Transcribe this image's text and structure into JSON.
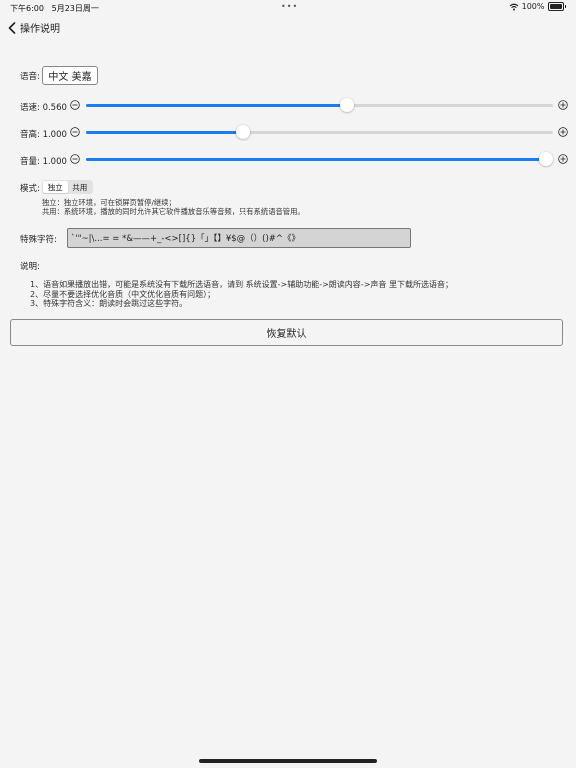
{
  "status": {
    "time": "下午6:00",
    "date": "5月23日周一",
    "dots": "•••",
    "battery": "100%"
  },
  "nav": {
    "back_label": "操作说明"
  },
  "voice": {
    "label": "语音:",
    "value": "中文 美嘉"
  },
  "sliders": [
    {
      "label": "语速: 0.560",
      "fraction": 0.558
    },
    {
      "label": "音高: 1.000",
      "fraction": 0.336
    },
    {
      "label": "音量: 1.000",
      "fraction": 0.985
    }
  ],
  "mode": {
    "label": "模式:",
    "options": [
      "独立",
      "共用"
    ],
    "selected": "独立",
    "desc_independent": "独立：独立环境，可在锁屏页暂停/继续；",
    "desc_shared": "共用：系统环境，播放的同时允许其它软件播放音乐等音频，只有系统语音管用。"
  },
  "special": {
    "label": "特殊字符:",
    "value": "`'\"~|\\...= = *&——+_-<>[]{}「」【】¥$@（）()#^《》"
  },
  "notes": {
    "title": "说明:",
    "items": [
      "1、语音如果播放出错，可能是系统没有下载所选语音，请到 系统设置->辅助功能->朗读内容->声音 里下载所选语音；",
      "2、尽量不要选择优化音质（中文优化音质有问题）；",
      "3、特殊字符含义：朗读时会跳过这些字符。"
    ]
  },
  "reset": {
    "label": "恢复默认"
  },
  "colors": {
    "accent": "#1a7cf0",
    "background": "#f4f4f4"
  }
}
